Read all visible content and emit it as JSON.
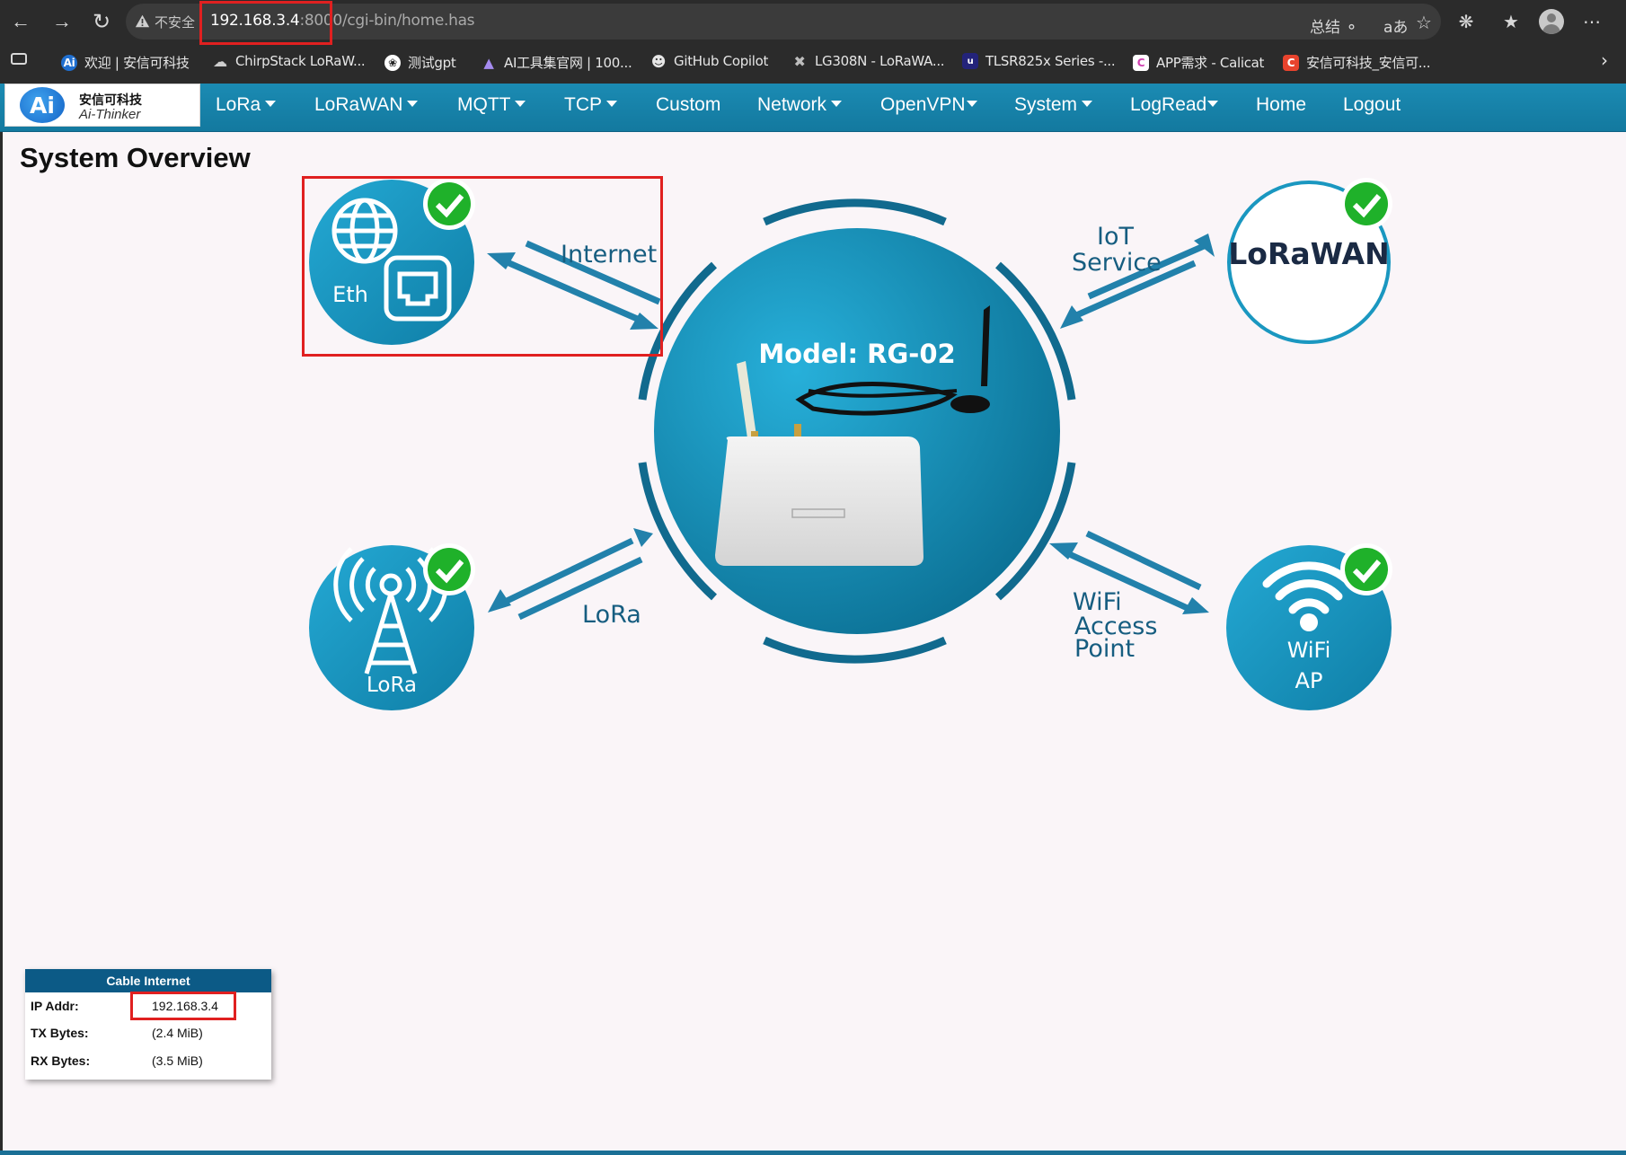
{
  "browser": {
    "insecure_label": "不安全",
    "url_host": "192.168.3.4",
    "url_port": ":8000",
    "url_path": "/cgi-bin/home.has",
    "summary_label": "总结",
    "bookmarks": [
      {
        "label": "欢迎 | 安信可科技",
        "icon": "ai-thinker-icon",
        "color": "#1f6fd0"
      },
      {
        "label": "ChirpStack LoRaW...",
        "icon": "cloud-icon",
        "color": "#555555"
      },
      {
        "label": "测试gpt",
        "icon": "openai-icon",
        "color": "#444444"
      },
      {
        "label": "AI工具集官网 | 100...",
        "icon": "ai-tools-icon",
        "color": "#7b5bd6"
      },
      {
        "label": "GitHub Copilot",
        "icon": "copilot-icon",
        "color": "#444444"
      },
      {
        "label": "LG308N - LoRaWA...",
        "icon": "dragino-icon",
        "color": "#666666"
      },
      {
        "label": "TLSR825x Series -...",
        "icon": "telink-icon",
        "color": "#2a2a8a"
      },
      {
        "label": "APP需求 - Calicat",
        "icon": "calicat-icon",
        "color": "#ffffff"
      },
      {
        "label": "安信可科技_安信可...",
        "icon": "csdn-icon",
        "color": "#e8432d"
      }
    ]
  },
  "logo": {
    "mark": "Ai",
    "cn": "安信可科技",
    "en": "Ai-Thinker"
  },
  "menu": [
    {
      "label": "LoRa",
      "dropdown": true
    },
    {
      "label": "LoRaWAN",
      "dropdown": true
    },
    {
      "label": "MQTT",
      "dropdown": true
    },
    {
      "label": "TCP",
      "dropdown": true
    },
    {
      "label": "Custom",
      "dropdown": false
    },
    {
      "label": "Network",
      "dropdown": true
    },
    {
      "label": "OpenVPN",
      "dropdown": true
    },
    {
      "label": "System",
      "dropdown": true
    },
    {
      "label": "LogRead",
      "dropdown": true
    },
    {
      "label": "Home",
      "dropdown": false
    },
    {
      "label": "Logout",
      "dropdown": false
    }
  ],
  "page": {
    "title": "System Overview"
  },
  "diagram": {
    "model": "Model: RG-02",
    "eth_label": "Eth",
    "internet_label": "Internet",
    "iot_label_1": "IoT",
    "iot_label_2": "Service",
    "lorawan_logo": "LoRaWAN",
    "lora_label": "LoRa",
    "lora_arrow_label": "LoRa",
    "wifi_arrow_1": "WiFi",
    "wifi_arrow_2": "Access",
    "wifi_arrow_3": "Point",
    "wifi_label_1": "WiFi",
    "wifi_label_2": "AP",
    "colors": {
      "node": "#1a97c0",
      "arrow": "#2281ab",
      "check": "#1fb12a"
    }
  },
  "cable_internet": {
    "title": "Cable Internet",
    "ip_label": "IP Addr:",
    "ip_value": "192.168.3.4",
    "tx_label": "TX Bytes:",
    "tx_value": "(2.4 MiB)",
    "rx_label": "RX Bytes:",
    "rx_value": "(3.5 MiB)"
  }
}
